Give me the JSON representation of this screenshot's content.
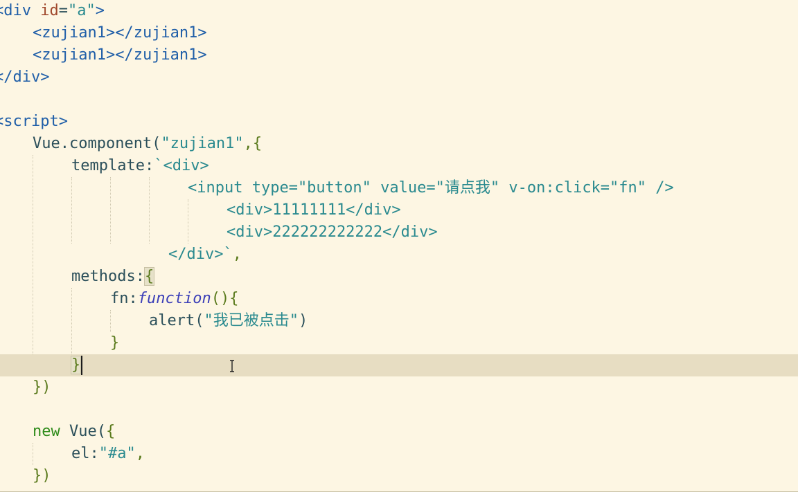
{
  "editor": {
    "lines": [
      [
        {
          "c": "t-tag",
          "t": "<div"
        },
        {
          "c": "t-id",
          "t": " "
        },
        {
          "c": "t-attr",
          "t": "id"
        },
        {
          "c": "t-id",
          "t": "="
        },
        {
          "c": "t-str",
          "t": "\"a\""
        },
        {
          "c": "t-tag",
          "t": ">"
        }
      ],
      [
        {
          "c": "t-tag",
          "t": "<zujian1></zujian1>"
        }
      ],
      [
        {
          "c": "t-tag",
          "t": "<zujian1></zujian1>"
        }
      ],
      [
        {
          "c": "t-tag",
          "t": "</div>"
        }
      ],
      [],
      [
        {
          "c": "t-tag",
          "t": "<script>"
        }
      ],
      [
        {
          "c": "t-id",
          "t": "Vue.component("
        },
        {
          "c": "t-str",
          "t": "\"zujian1\""
        },
        {
          "c": "t-punc",
          "t": ",{"
        }
      ],
      [
        {
          "c": "t-id",
          "t": "template:"
        },
        {
          "c": "t-str",
          "t": "`"
        },
        {
          "c": "t-html",
          "t": "<div>"
        }
      ],
      [
        {
          "c": "t-html",
          "t": "<input type=\"button\" value=\"请点我\" v-on:click=\"fn\" />"
        }
      ],
      [
        {
          "c": "t-html",
          "t": "<div>11111111</div>"
        }
      ],
      [
        {
          "c": "t-html",
          "t": "<div>222222222222</div>"
        }
      ],
      [
        {
          "c": "t-html",
          "t": "</div>`"
        },
        {
          "c": "t-punc",
          "t": ","
        }
      ],
      [
        {
          "c": "t-id",
          "t": "methods:"
        },
        {
          "c": "t-punc brace-hl",
          "t": "{"
        }
      ],
      [
        {
          "c": "t-id",
          "t": "fn:"
        },
        {
          "c": "t-fn",
          "t": "function"
        },
        {
          "c": "t-punc",
          "t": "(){"
        }
      ],
      [
        {
          "c": "t-id",
          "t": "alert("
        },
        {
          "c": "t-str",
          "t": "\"我已被点击\""
        },
        {
          "c": "t-id",
          "t": ")"
        }
      ],
      [
        {
          "c": "t-punc",
          "t": "}"
        }
      ],
      [
        {
          "c": "t-punc brace-hl",
          "t": "}"
        }
      ],
      [
        {
          "c": "t-punc",
          "t": "})"
        }
      ],
      [],
      [
        {
          "c": "t-kw",
          "t": "new"
        },
        {
          "c": "t-id",
          "t": " Vue("
        },
        {
          "c": "t-punc",
          "t": "{"
        }
      ],
      [
        {
          "c": "t-id",
          "t": "el:"
        },
        {
          "c": "t-str",
          "t": "\"#a\""
        },
        {
          "c": "t-punc",
          "t": ","
        }
      ],
      [
        {
          "c": "t-punc",
          "t": "})"
        }
      ]
    ]
  },
  "colors": {
    "background": "#fdf6e3",
    "current_line": "#e7ddc2",
    "tag": "#1f5ea8",
    "attribute": "#a0482c",
    "string": "#2a8a8f",
    "keyword": "#2e8b1a",
    "function_keyword": "#3b3fb8"
  }
}
